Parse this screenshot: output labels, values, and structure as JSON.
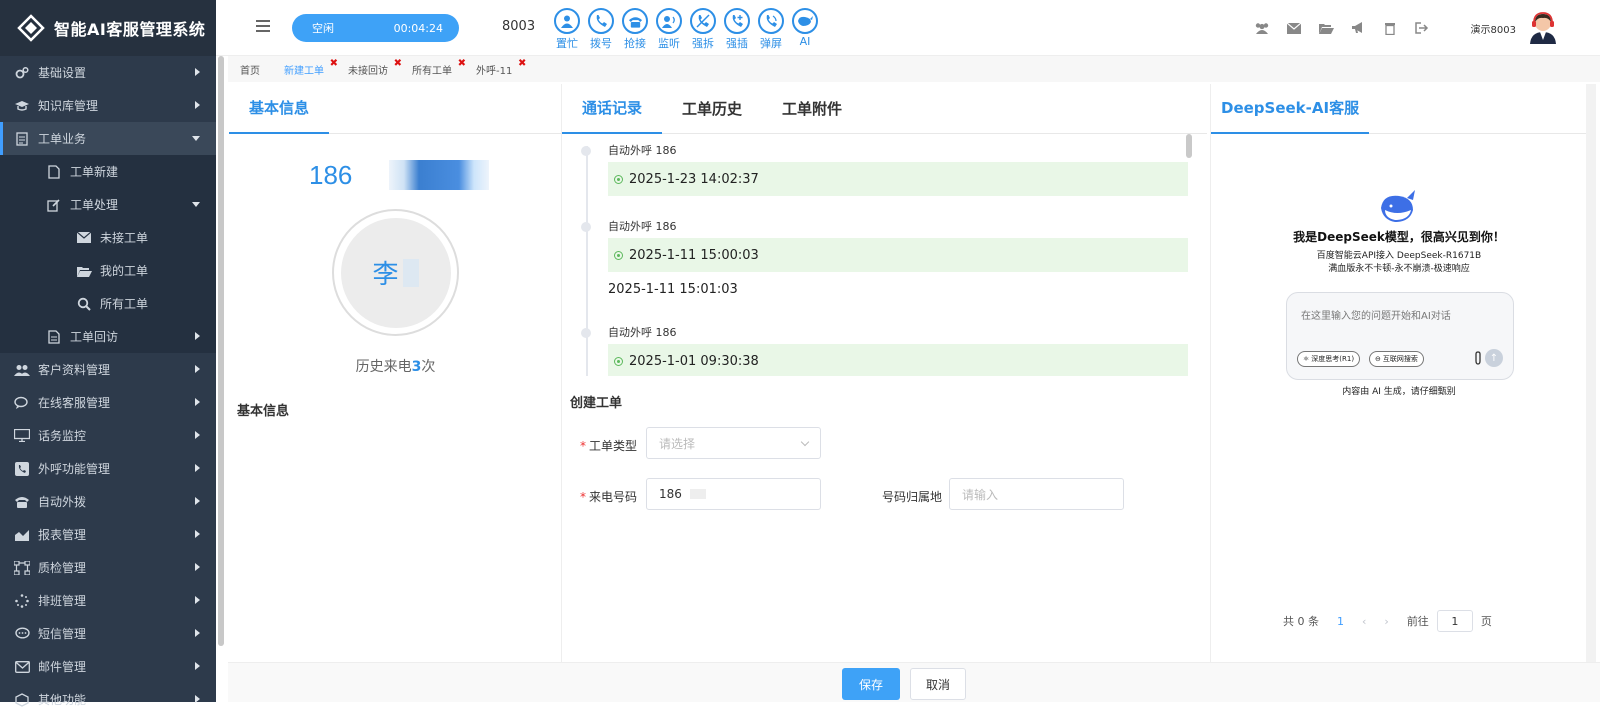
{
  "app": {
    "title": "智能AI客服管理系统"
  },
  "sidebar": {
    "items": [
      {
        "label": "基础设置",
        "icon": "gears-icon"
      },
      {
        "label": "知识库管理",
        "icon": "graduation-cap-icon"
      },
      {
        "label": "工单业务",
        "icon": "document-icon",
        "expanded": true
      },
      {
        "label": "客户资料管理",
        "icon": "users-icon"
      },
      {
        "label": "在线客服管理",
        "icon": "chat-bubbles-icon"
      },
      {
        "label": "话务监控",
        "icon": "monitor-icon"
      },
      {
        "label": "外呼功能管理",
        "icon": "phone-square-icon"
      },
      {
        "label": "自动外拨",
        "icon": "telephone-icon"
      },
      {
        "label": "报表管理",
        "icon": "area-chart-icon"
      },
      {
        "label": "质检管理",
        "icon": "sitemap-icon"
      },
      {
        "label": "排班管理",
        "icon": "spinner-icon"
      },
      {
        "label": "短信管理",
        "icon": "comment-icon"
      },
      {
        "label": "邮件管理",
        "icon": "envelope-icon"
      },
      {
        "label": "其他功能",
        "icon": "cube-icon"
      }
    ],
    "workorder_sub": [
      {
        "label": "工单新建",
        "icon": "file-icon"
      },
      {
        "label": "工单处理",
        "icon": "edit-icon"
      },
      {
        "label": "工单回访",
        "icon": "file-text-icon"
      }
    ],
    "processing_sub": [
      {
        "label": "未接工单",
        "icon": "envelope-icon"
      },
      {
        "label": "我的工单",
        "icon": "folder-open-icon"
      },
      {
        "label": "所有工单",
        "icon": "search-icon"
      }
    ]
  },
  "topbar": {
    "status": "空闲",
    "timer": "00:04:24",
    "extension": "8003",
    "phone_tools": [
      "置忙",
      "拨号",
      "抢接",
      "监听",
      "强拆",
      "强插",
      "弹屏",
      "AI"
    ],
    "user": "演示8003"
  },
  "tabs": [
    {
      "label": "首页"
    },
    {
      "label": "新建工单",
      "active": true,
      "closable": true
    },
    {
      "label": "未接回访",
      "closable": true
    },
    {
      "label": "所有工单",
      "closable": true
    },
    {
      "label": "外呼-11",
      "closable": true
    }
  ],
  "left_panel": {
    "tab": "基本信息",
    "caller_number": "186",
    "caller_name": "李",
    "history_prefix": "历史来电",
    "history_count": "3",
    "history_suffix": "次",
    "section": "基本信息"
  },
  "mid_panel": {
    "tabs": [
      "通话记录",
      "工单历史",
      "工单附件"
    ],
    "records": [
      {
        "title": "自动外呼 186",
        "time": "2025-1-23 14:02:37"
      },
      {
        "title": "自动外呼 186",
        "time": "2025-1-11 15:00:03",
        "end": "2025-1-11 15:01:03"
      },
      {
        "title": "自动外呼 186",
        "time": "2025-1-01 09:30:38"
      }
    ],
    "create_title": "创建工单",
    "type_label": "工单类型",
    "type_placeholder": "请选择",
    "phone_label": "来电号码",
    "phone_value": "186",
    "region_label": "号码归属地",
    "region_placeholder": "请输入"
  },
  "right_panel": {
    "title": "DeepSeek-AI客服",
    "greeting": "我是DeepSeek模型，很高兴见到你！",
    "line1": "百度智能云API接入 DeepSeek-R1671B",
    "line2": "满血版永不卡顿-永不崩溃-极速响应",
    "input_placeholder": "在这里输入您的问题开始和AI对话",
    "chip_think": "深度思考(R1)",
    "chip_search": "互联网搜索",
    "note": "内容由 AI 生成，请仔细甄别",
    "pager_total": "共 0 条",
    "pager_current": "1",
    "pager_goto": "前往",
    "pager_page": "1",
    "pager_unit": "页"
  },
  "footer": {
    "save": "保存",
    "cancel": "取消"
  },
  "colors": {
    "accent": "#3ea2f7",
    "sidebar": "#2d3a4b",
    "success_bg": "#e9f7e7"
  }
}
